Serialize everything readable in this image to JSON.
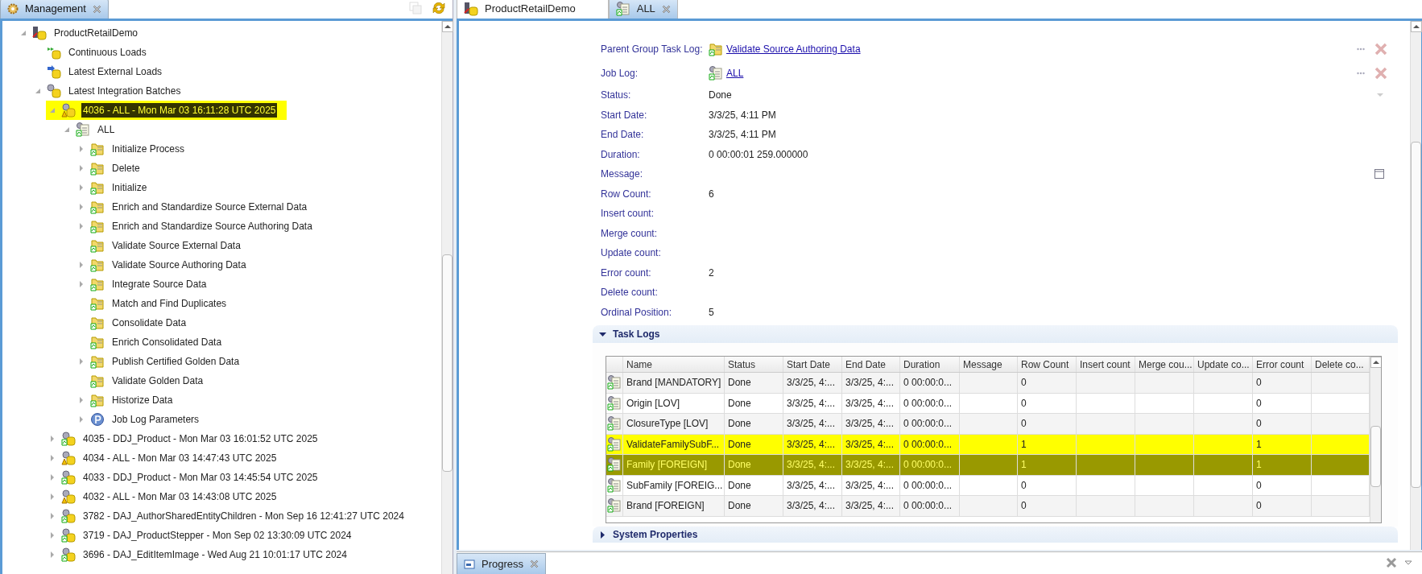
{
  "left_panel": {
    "tab": {
      "label": "Management",
      "selected": true
    },
    "tree": [
      {
        "label": "ProductRetailDemo",
        "kind": "model",
        "expandable": true,
        "expanded": true,
        "selected": false,
        "highlighted": false,
        "children": [
          {
            "label": "Continuous Loads",
            "kind": "continuous",
            "expandable": false,
            "expanded": false,
            "selected": false,
            "highlighted": false
          },
          {
            "label": "Latest External Loads",
            "kind": "external",
            "expandable": false,
            "expanded": false,
            "selected": false,
            "highlighted": false
          },
          {
            "label": "Latest Integration Batches",
            "kind": "batches",
            "expandable": true,
            "expanded": true,
            "selected": false,
            "highlighted": false,
            "children": [
              {
                "label": "4036 - ALL - Mon Mar 03 16:11:28 UTC 2025",
                "kind": "warning",
                "expandable": true,
                "expanded": true,
                "selected": true,
                "highlighted": true,
                "children": [
                  {
                    "label": "ALL",
                    "kind": "job",
                    "expandable": true,
                    "expanded": true,
                    "selected": false,
                    "highlighted": false,
                    "children": [
                      {
                        "label": "Initialize Process",
                        "kind": "task",
                        "expandable": true,
                        "expanded": false,
                        "selected": false,
                        "highlighted": false
                      },
                      {
                        "label": "Delete",
                        "kind": "task",
                        "expandable": true,
                        "expanded": false,
                        "selected": false,
                        "highlighted": false
                      },
                      {
                        "label": "Initialize",
                        "kind": "task",
                        "expandable": true,
                        "expanded": false,
                        "selected": false,
                        "highlighted": false
                      },
                      {
                        "label": "Enrich and Standardize Source External Data",
                        "kind": "task",
                        "expandable": true,
                        "expanded": false,
                        "selected": false,
                        "highlighted": false
                      },
                      {
                        "label": "Enrich and Standardize Source Authoring Data",
                        "kind": "task",
                        "expandable": true,
                        "expanded": false,
                        "selected": false,
                        "highlighted": false
                      },
                      {
                        "label": "Validate Source External Data",
                        "kind": "task",
                        "expandable": false,
                        "expanded": false,
                        "selected": false,
                        "highlighted": false
                      },
                      {
                        "label": "Validate Source Authoring Data",
                        "kind": "task",
                        "expandable": true,
                        "expanded": false,
                        "selected": false,
                        "highlighted": false
                      },
                      {
                        "label": "Integrate Source Data",
                        "kind": "task",
                        "expandable": true,
                        "expanded": false,
                        "selected": false,
                        "highlighted": false
                      },
                      {
                        "label": "Match and Find Duplicates",
                        "kind": "task",
                        "expandable": false,
                        "expanded": false,
                        "selected": false,
                        "highlighted": false
                      },
                      {
                        "label": "Consolidate Data",
                        "kind": "task",
                        "expandable": false,
                        "expanded": false,
                        "selected": false,
                        "highlighted": false
                      },
                      {
                        "label": "Enrich Consolidated Data",
                        "kind": "task",
                        "expandable": false,
                        "expanded": false,
                        "selected": false,
                        "highlighted": false
                      },
                      {
                        "label": "Publish Certified Golden Data",
                        "kind": "task",
                        "expandable": true,
                        "expanded": false,
                        "selected": false,
                        "highlighted": false
                      },
                      {
                        "label": "Validate Golden Data",
                        "kind": "task",
                        "expandable": false,
                        "expanded": false,
                        "selected": false,
                        "highlighted": false
                      },
                      {
                        "label": "Historize Data",
                        "kind": "task",
                        "expandable": true,
                        "expanded": false,
                        "selected": false,
                        "highlighted": false
                      },
                      {
                        "label": "Job Log Parameters",
                        "kind": "parameter",
                        "expandable": true,
                        "expanded": false,
                        "selected": false,
                        "highlighted": false
                      }
                    ]
                  }
                ]
              },
              {
                "label": "4035 - DDJ_Product - Mon Mar 03 16:01:52 UTC 2025",
                "kind": "success",
                "expandable": true,
                "expanded": false,
                "selected": false,
                "highlighted": false
              },
              {
                "label": "4034 - ALL - Mon Mar 03 14:47:43 UTC 2025",
                "kind": "warning",
                "expandable": true,
                "expanded": false,
                "selected": false,
                "highlighted": false
              },
              {
                "label": "4033 - DDJ_Product - Mon Mar 03 14:45:54 UTC 2025",
                "kind": "success",
                "expandable": true,
                "expanded": false,
                "selected": false,
                "highlighted": false
              },
              {
                "label": "4032 - ALL - Mon Mar 03 14:43:08 UTC 2025",
                "kind": "warning",
                "expandable": true,
                "expanded": false,
                "selected": false,
                "highlighted": false
              },
              {
                "label": "3782 - DAJ_AuthorSharedEntityChildren - Mon Sep 16 12:41:27 UTC 2024",
                "kind": "success",
                "expandable": true,
                "expanded": false,
                "selected": false,
                "highlighted": false
              },
              {
                "label": "3719 - DAJ_ProductStepper - Mon Sep 02 13:30:09 UTC 2024",
                "kind": "success",
                "expandable": true,
                "expanded": false,
                "selected": false,
                "highlighted": false
              },
              {
                "label": "3696 - DAJ_EditItemImage - Wed Aug 21 10:01:17 UTC 2024",
                "kind": "success",
                "expandable": true,
                "expanded": false,
                "selected": false,
                "highlighted": false
              }
            ]
          }
        ]
      }
    ]
  },
  "editor": {
    "tabs": [
      {
        "label": "ProductRetailDemo",
        "kind": "model",
        "selected": false
      },
      {
        "label": "ALL",
        "kind": "job",
        "selected": true
      }
    ],
    "fields": [
      {
        "label": "Parent Group Task Log:",
        "kind": "link",
        "value": "Validate Source Authoring Data"
      },
      {
        "label": "Job Log:",
        "kind": "link",
        "value": "ALL"
      },
      {
        "label": "Status:",
        "kind": "select",
        "value": "Done"
      },
      {
        "label": "Start Date:",
        "kind": "text",
        "value": "3/3/25, 4:11 PM"
      },
      {
        "label": "End Date:",
        "kind": "text",
        "value": "3/3/25, 4:11 PM"
      },
      {
        "label": "Duration:",
        "kind": "text",
        "value": "0 00:00:01 259.000000"
      },
      {
        "label": "Message:",
        "kind": "memo"
      },
      {
        "label": "Row Count:",
        "kind": "text",
        "value": "6"
      },
      {
        "label": "Insert count:",
        "kind": "text"
      },
      {
        "label": "Merge count:",
        "kind": "text"
      },
      {
        "label": "Update count:",
        "kind": "text"
      },
      {
        "label": "Error count:",
        "kind": "text",
        "value": "2"
      },
      {
        "label": "Delete count:",
        "kind": "text"
      },
      {
        "label": "Ordinal Position:",
        "kind": "text",
        "value": "5"
      }
    ],
    "task_logs": {
      "title": "Task Logs",
      "expanded": true,
      "columns": [
        "Name",
        "Status",
        "Start Date",
        "End Date",
        "Duration",
        "Message",
        "Row Count",
        "Insert count",
        "Merge cou...",
        "Update co...",
        "Error count",
        "Delete co..."
      ],
      "rows": [
        {
          "name": "Brand [MANDATORY]",
          "status": "Done",
          "start_date": "3/3/25, 4:...",
          "end_date": "3/3/25, 4:...",
          "duration": "0 00:00:0...",
          "row_count": "0",
          "error_count": "0",
          "highlighted": false,
          "selected": false
        },
        {
          "name": "Origin [LOV]",
          "status": "Done",
          "start_date": "3/3/25, 4:...",
          "end_date": "3/3/25, 4:...",
          "duration": "0 00:00:0...",
          "row_count": "0",
          "error_count": "0",
          "highlighted": false,
          "selected": false
        },
        {
          "name": "ClosureType [LOV]",
          "status": "Done",
          "start_date": "3/3/25, 4:...",
          "end_date": "3/3/25, 4:...",
          "duration": "0 00:00:0...",
          "row_count": "0",
          "error_count": "0",
          "highlighted": false,
          "selected": false
        },
        {
          "name": "ValidateFamilySubF...",
          "status": "Done",
          "start_date": "3/3/25, 4:...",
          "end_date": "3/3/25, 4:...",
          "duration": "0 00:00:0...",
          "row_count": "1",
          "error_count": "1",
          "highlighted": true,
          "selected": false
        },
        {
          "name": "Family [FOREIGN]",
          "status": "Done",
          "start_date": "3/3/25, 4:...",
          "end_date": "3/3/25, 4:...",
          "duration": "0 00:00:0...",
          "row_count": "1",
          "error_count": "1",
          "highlighted": true,
          "selected": true
        },
        {
          "name": "SubFamily [FOREIG...",
          "status": "Done",
          "start_date": "3/3/25, 4:...",
          "end_date": "3/3/25, 4:...",
          "duration": "0 00:00:0...",
          "row_count": "0",
          "error_count": "0",
          "highlighted": false,
          "selected": false
        },
        {
          "name": "Brand [FOREIGN]",
          "status": "Done",
          "start_date": "3/3/25, 4:...",
          "end_date": "3/3/25, 4:...",
          "duration": "0 00:00:0...",
          "row_count": "0",
          "error_count": "0",
          "highlighted": false,
          "selected": false
        }
      ]
    },
    "system_properties": {
      "title": "System Properties",
      "expanded": false
    }
  },
  "progress_panel": {
    "tab": {
      "label": "Progress",
      "selected": true
    }
  }
}
